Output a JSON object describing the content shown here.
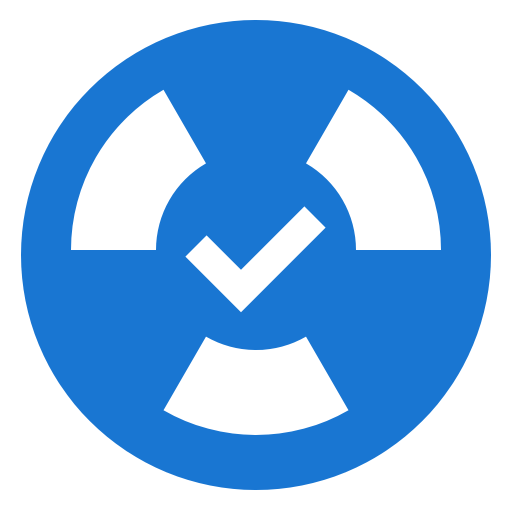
{
  "icon": {
    "name": "radiation-check-icon",
    "colors": {
      "background_circle": "#1976D2",
      "foreground": "#FFFFFF",
      "page_background": "#FFFFFF"
    }
  }
}
